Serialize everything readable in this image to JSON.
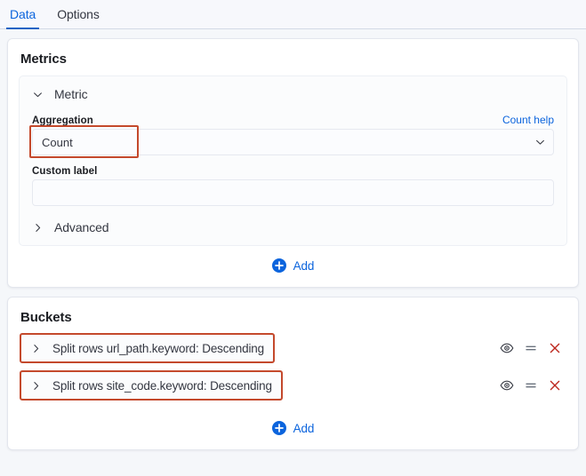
{
  "tabs": [
    {
      "label": "Data",
      "active": true
    },
    {
      "label": "Options",
      "active": false
    }
  ],
  "metrics": {
    "title": "Metrics",
    "metric_accordion": {
      "label": "Metric",
      "chevron": "chevron-down-icon",
      "expanded": true
    },
    "aggregation": {
      "label": "Aggregation",
      "help_link": "Count help",
      "value": "Count",
      "dropdown_icon": "chevron-down-icon",
      "highlighted": true,
      "highlight_color": "#C4492C"
    },
    "custom_label": {
      "label": "Custom label",
      "value": "",
      "placeholder": ""
    },
    "advanced_accordion": {
      "label": "Advanced",
      "chevron": "chevron-right-icon",
      "expanded": false
    },
    "add_button": {
      "label": "Add",
      "icon": "plus-circle-icon",
      "color": "#0B64DD"
    }
  },
  "buckets": {
    "title": "Buckets",
    "rows": [
      {
        "text": "Split rows url_path.keyword: Descending",
        "chevron": "chevron-right-icon",
        "highlighted": true,
        "actions": [
          {
            "name": "toggle-visibility-icon",
            "glyph": "eye"
          },
          {
            "name": "drag-handle-icon",
            "glyph": "equals"
          },
          {
            "name": "remove-icon",
            "glyph": "cross",
            "color": "#BD271E"
          }
        ]
      },
      {
        "text": "Split rows site_code.keyword: Descending",
        "chevron": "chevron-right-icon",
        "highlighted": true,
        "actions": [
          {
            "name": "toggle-visibility-icon",
            "glyph": "eye"
          },
          {
            "name": "drag-handle-icon",
            "glyph": "equals"
          },
          {
            "name": "remove-icon",
            "glyph": "cross",
            "color": "#BD271E"
          }
        ]
      }
    ],
    "add_button": {
      "label": "Add",
      "icon": "plus-circle-icon",
      "color": "#0B64DD"
    }
  }
}
